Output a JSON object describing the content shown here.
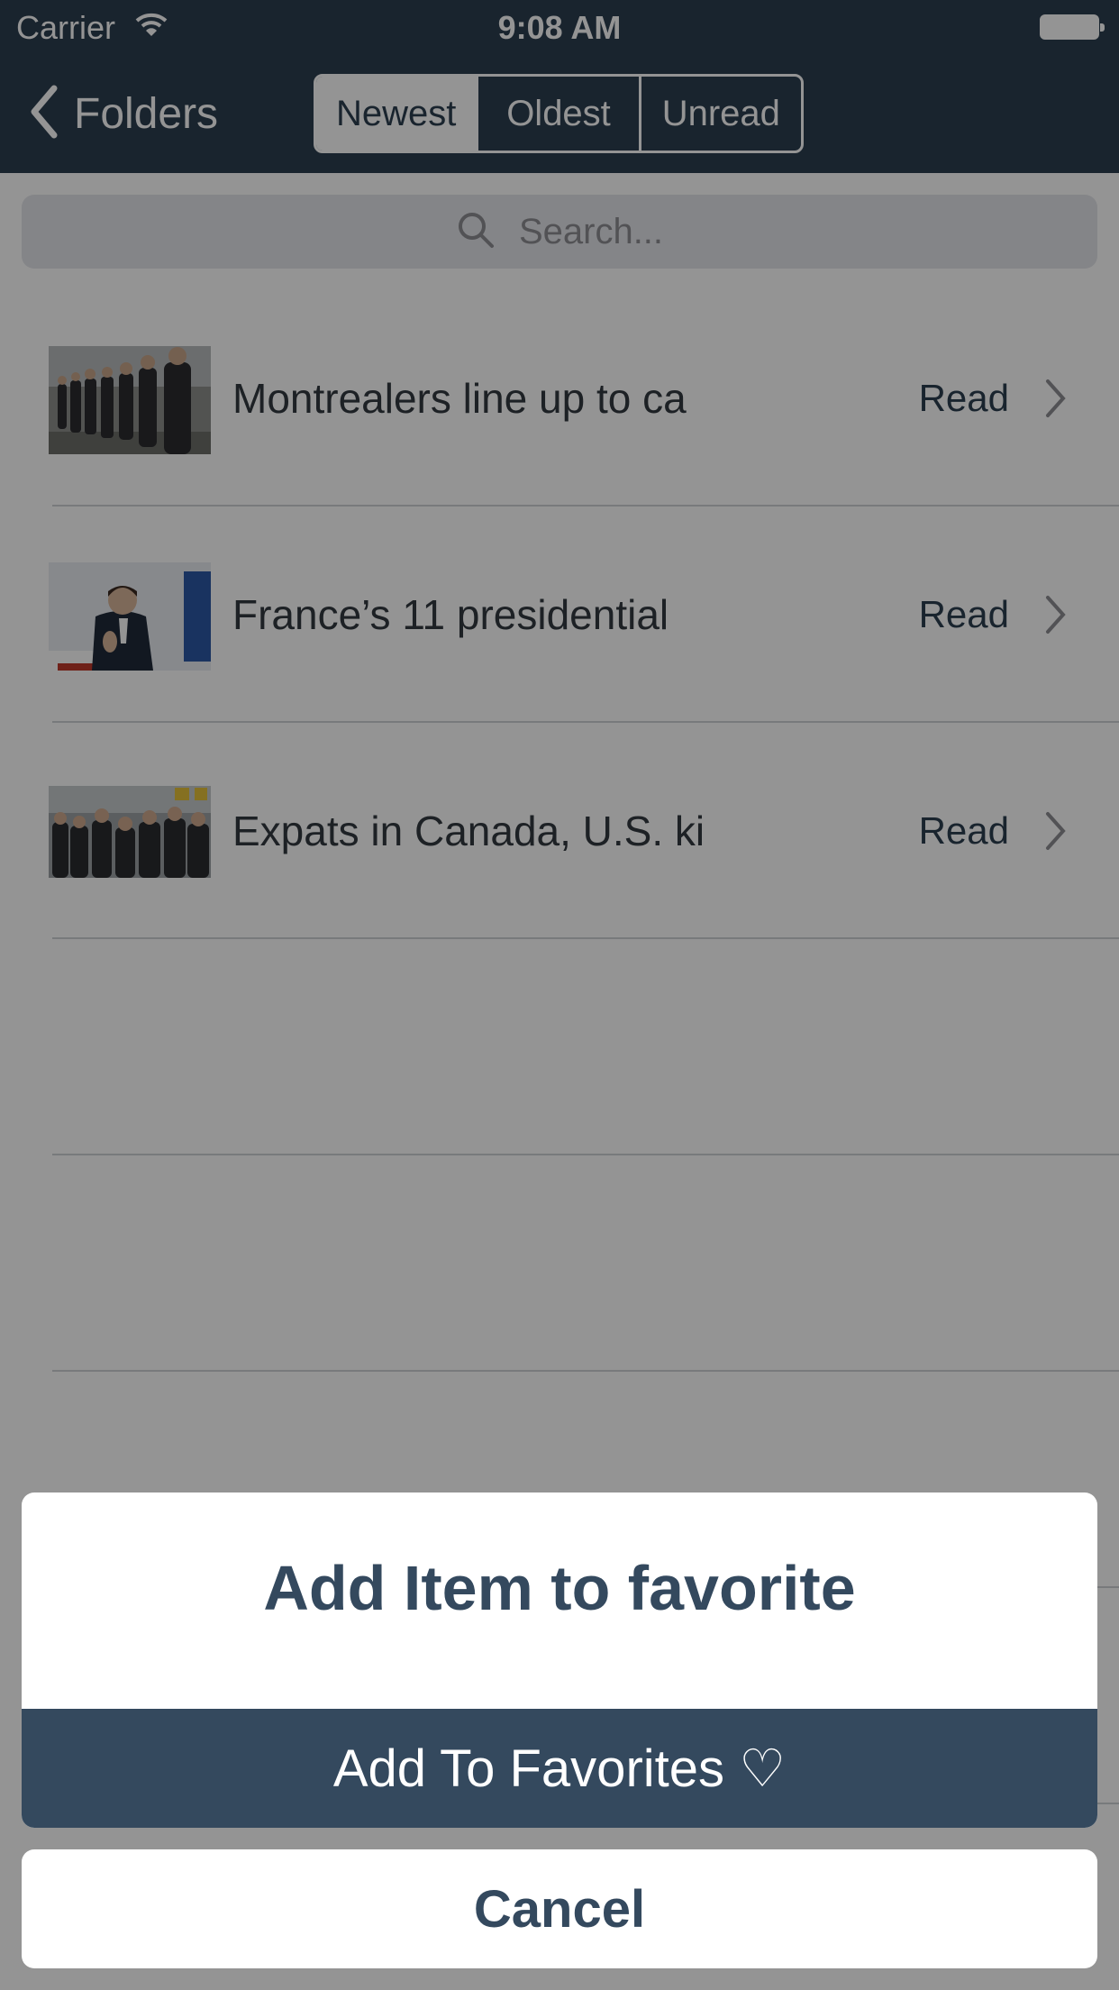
{
  "status_bar": {
    "carrier": "Carrier",
    "time": "9:08 AM"
  },
  "nav": {
    "back_label": "Folders",
    "segments": [
      {
        "label": "Newest",
        "selected": true
      },
      {
        "label": "Oldest",
        "selected": false
      },
      {
        "label": "Unread",
        "selected": false
      }
    ]
  },
  "search": {
    "placeholder": "Search..."
  },
  "articles": [
    {
      "title": "Montrealers line up to ca",
      "action": "Read",
      "thumbnail": "people-queue-photo"
    },
    {
      "title": "France’s 11 presidential",
      "action": "Read",
      "thumbnail": "speaker-at-podium-photo"
    },
    {
      "title": "Expats in Canada, U.S. ki",
      "action": "Read",
      "thumbnail": "crowd-photo"
    }
  ],
  "action_sheet": {
    "title": "Add Item to favorite",
    "primary_action": "Add To Favorites ♡",
    "cancel": "Cancel"
  },
  "colors": {
    "nav_bar": "#2c3e50",
    "accent": "#34495e",
    "dim_overlay": "rgba(0,0,0,0.42)"
  }
}
